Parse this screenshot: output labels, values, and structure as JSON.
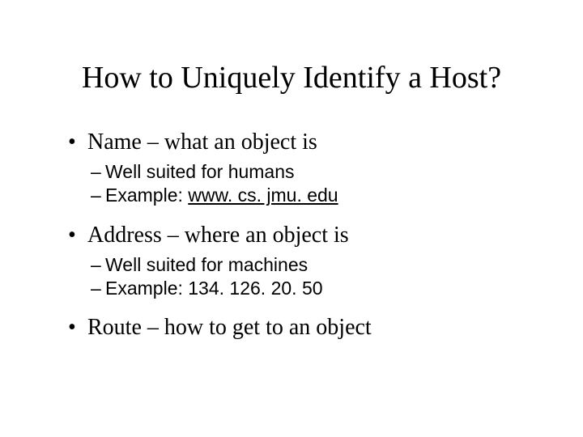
{
  "title": "How to Uniquely Identify a Host?",
  "b1": {
    "text": "Name – what an object is"
  },
  "b1s1": "Well suited for humans",
  "b1s2_label": "Example: ",
  "b1s2_link": "www. cs. jmu. edu",
  "b2": {
    "text": "Address – where an object is"
  },
  "b2s1": "Well suited for machines",
  "b2s2": "Example: 134. 126. 20. 50",
  "b3": {
    "text": "Route – how to get to an object"
  }
}
